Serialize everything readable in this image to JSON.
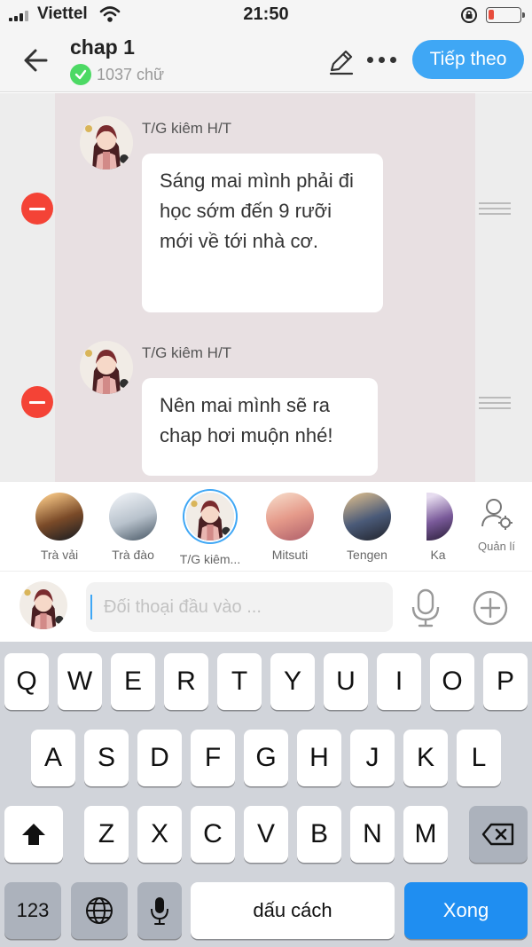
{
  "status_bar": {
    "carrier": "Viettel",
    "time": "21:50"
  },
  "nav": {
    "title": "chap 1",
    "word_count": "1037 chữ",
    "next_label": "Tiếp theo"
  },
  "messages": [
    {
      "speaker": "T/G kiêm H/T",
      "text": "Sáng mai mình phải đi học sớm đến 9 rưỡi mới về tới nhà cơ."
    },
    {
      "speaker": "T/G kiêm H/T",
      "text": "Nên mai mình sẽ ra chap hơi muộn nhé!"
    }
  ],
  "characters": [
    {
      "name": "Trà vải",
      "selected": false
    },
    {
      "name": "Trà đào",
      "selected": false
    },
    {
      "name": "T/G kiêm...",
      "selected": true
    },
    {
      "name": "Mitsuti",
      "selected": false
    },
    {
      "name": "Tengen",
      "selected": false
    },
    {
      "name": "Ka",
      "selected": false
    }
  ],
  "manage_label": "Quản lí",
  "input": {
    "placeholder": "Đối thoại đầu vào ..."
  },
  "keyboard": {
    "row1": [
      "Q",
      "W",
      "E",
      "R",
      "T",
      "Y",
      "U",
      "I",
      "O",
      "P"
    ],
    "row2": [
      "A",
      "S",
      "D",
      "F",
      "G",
      "H",
      "J",
      "K",
      "L"
    ],
    "row3": [
      "Z",
      "X",
      "C",
      "V",
      "B",
      "N",
      "M"
    ],
    "numbers_label": "123",
    "space_label": "dấu cách",
    "done_label": "Xong"
  },
  "colors": {
    "accent": "#3fa7f5",
    "remove": "#f44336",
    "keyboard_bg": "#d1d4da",
    "done_key": "#1f8ef1"
  }
}
